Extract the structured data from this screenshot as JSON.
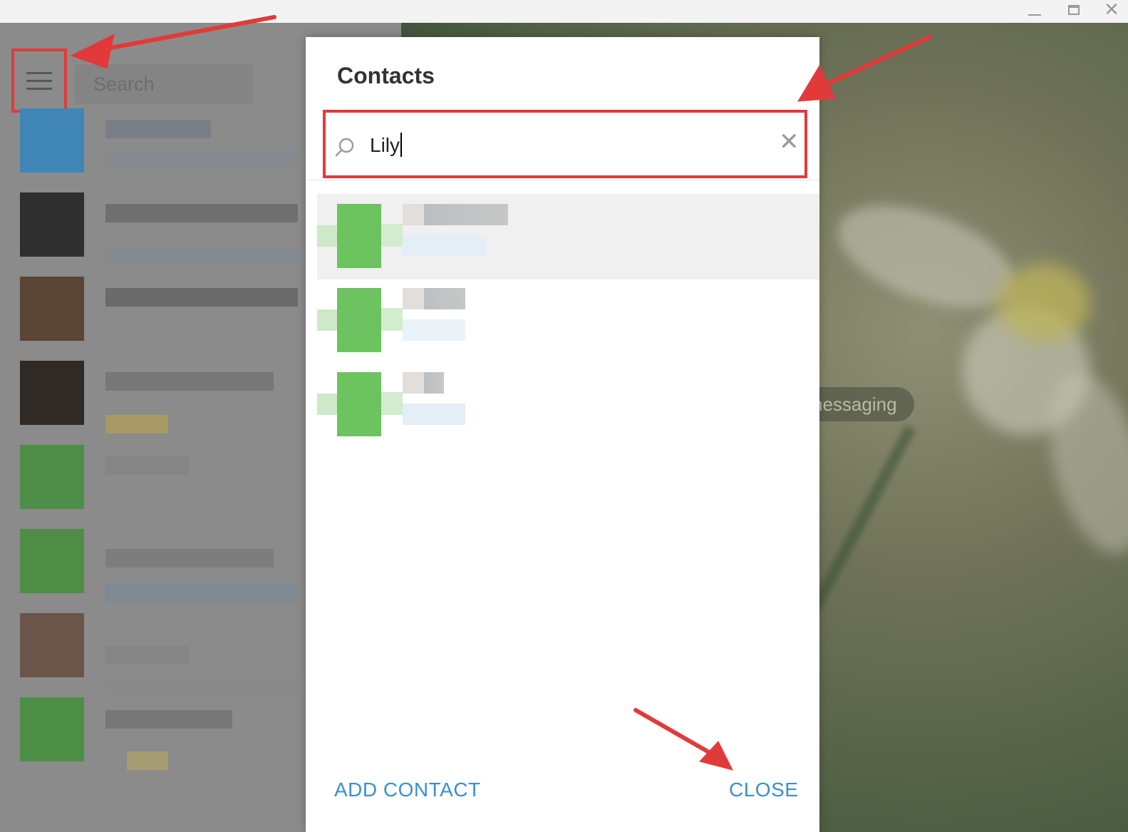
{
  "window": {
    "controls": {
      "minimize": "minimize-icon",
      "maximize": "maximize-icon",
      "close": "close-icon",
      "close_glyph": "✕"
    }
  },
  "sidebar": {
    "menu_icon": "hamburger-menu-icon",
    "search_placeholder": "Search"
  },
  "chat_area": {
    "service_pill_text": "nessaging"
  },
  "contacts_dialog": {
    "title": "Contacts",
    "search": {
      "value": "Lily",
      "clear_icon": "✕"
    },
    "footer": {
      "add_contact_label": "ADD CONTACT",
      "close_label": "CLOSE"
    }
  },
  "colors": {
    "accent": "#3a8fcf",
    "annotation_red": "#e23a3a",
    "avatar_green": "#6cc35f"
  }
}
